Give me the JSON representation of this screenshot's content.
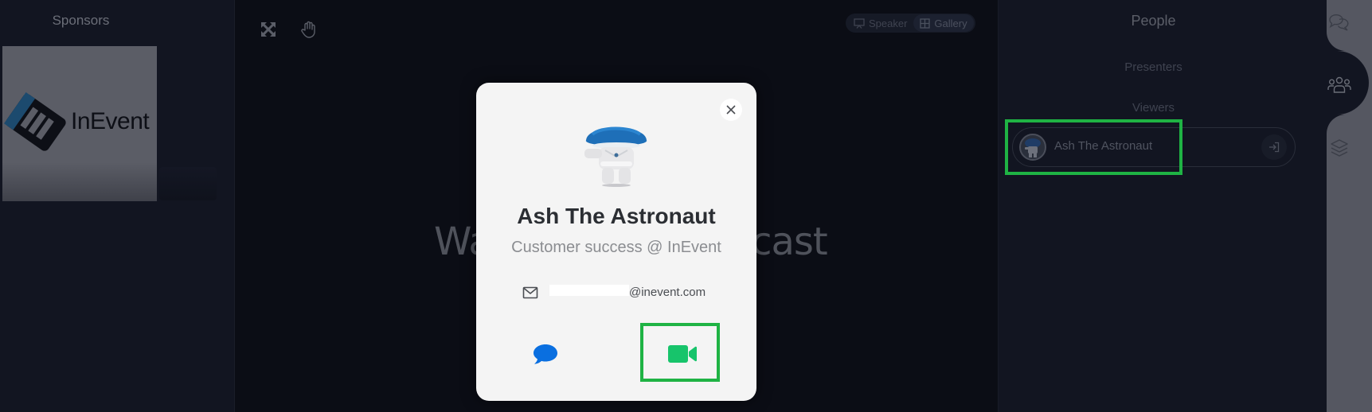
{
  "sponsors": {
    "title": "Sponsors",
    "items": [
      {
        "name": "InEvent",
        "logo_text": "InEvent"
      }
    ]
  },
  "stage": {
    "tools": [
      {
        "name": "fullscreen",
        "icon": "expand-arrows-icon"
      },
      {
        "name": "raise-hand",
        "icon": "hand-icon"
      }
    ],
    "layout_options": [
      {
        "label": "Speaker",
        "icon": "presentation-screen-icon",
        "active": false
      },
      {
        "label": "Gallery",
        "icon": "grid-icon",
        "active": true
      }
    ],
    "status_text": "Waiting for broadcast"
  },
  "people": {
    "title": "People",
    "sections": {
      "presenters": "Presenters",
      "viewers": "Viewers"
    },
    "viewers": [
      {
        "name": "Ash The Astronaut",
        "action_icon": "sign-in-icon"
      }
    ]
  },
  "rail": {
    "tabs": [
      {
        "name": "chat",
        "icon": "chat-bubbles-icon",
        "active": false
      },
      {
        "name": "people",
        "icon": "people-group-icon",
        "active": true
      },
      {
        "name": "layers",
        "icon": "layers-icon",
        "active": false
      }
    ]
  },
  "profile_modal": {
    "name": "Ash The Astronaut",
    "role": "Customer success @ InEvent",
    "email_visible_part": "@inevent.com",
    "email_icon": "envelope-icon",
    "actions": [
      {
        "name": "chat",
        "icon": "chat-bubble-icon",
        "color": "#0a6fe0"
      },
      {
        "name": "video-call",
        "icon": "video-camera-icon",
        "color": "#17c46b"
      }
    ],
    "close_icon": "close-icon"
  },
  "colors": {
    "highlight": "#1fb344",
    "modal_bg": "#f4f4f4",
    "panel_bg": "#121521",
    "stage_bg": "#0b0d15"
  }
}
